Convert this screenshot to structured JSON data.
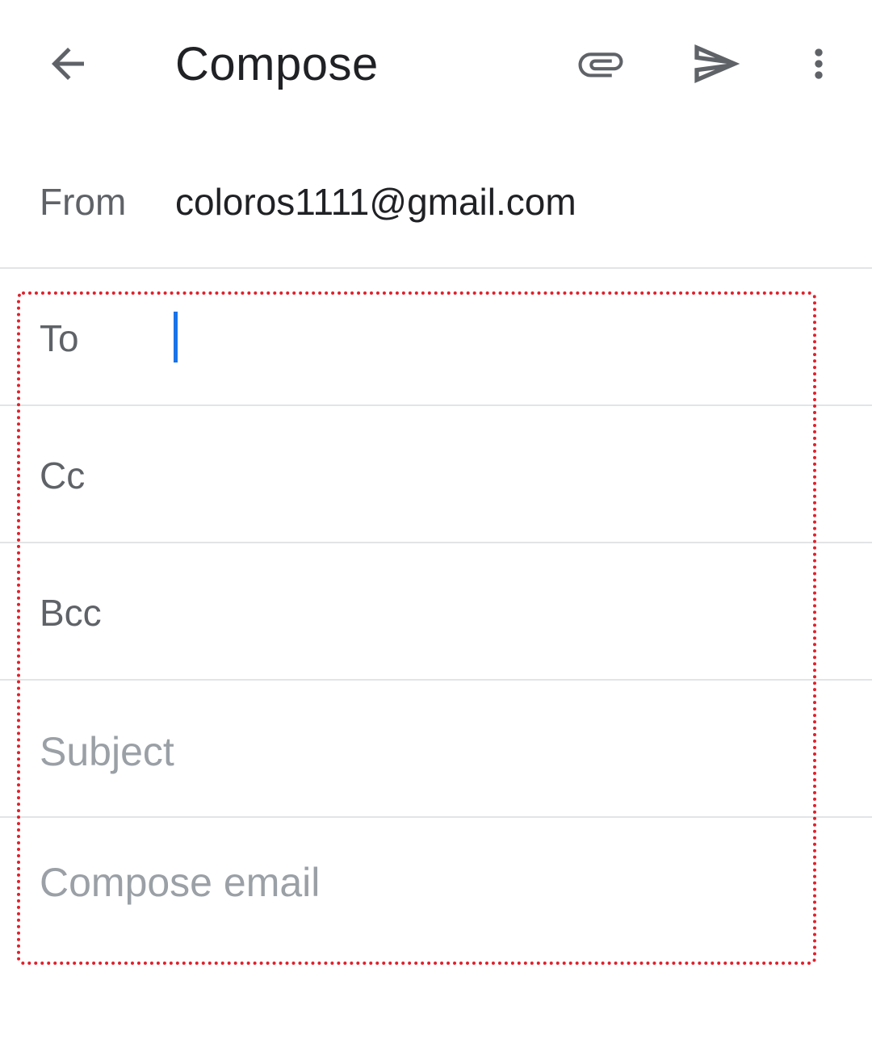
{
  "header": {
    "title": "Compose",
    "back_icon": "arrow-back-icon",
    "attach_icon": "paperclip-icon",
    "send_icon": "send-icon",
    "more_icon": "more-vert-icon"
  },
  "from": {
    "label": "From",
    "value": "coloros1111@gmail.com"
  },
  "to": {
    "label": "To",
    "value": ""
  },
  "cc": {
    "label": "Cc"
  },
  "bcc": {
    "label": "Bcc"
  },
  "subject": {
    "placeholder": "Subject"
  },
  "body": {
    "placeholder": "Compose email"
  },
  "colors": {
    "icon": "#5f6368",
    "text": "#202124",
    "label": "#5f6368",
    "placeholder": "#9aa0a6",
    "cursor": "#1a73e8",
    "divider": "#e3e4e6",
    "focus_outline": "#e0202b"
  }
}
